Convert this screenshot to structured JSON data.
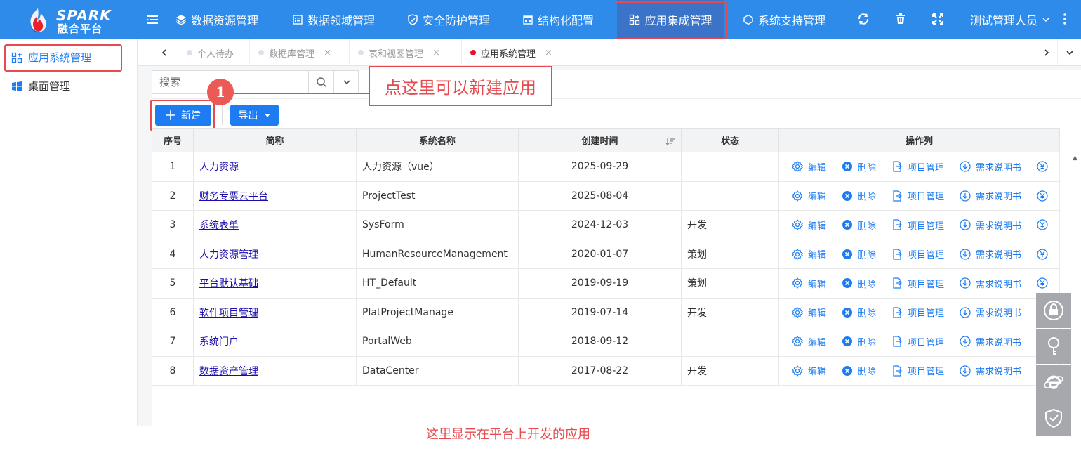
{
  "logo": {
    "top": "SPARK",
    "bottom": "融合平台"
  },
  "nav": [
    {
      "label": "数据资源管理",
      "icon": "layers-icon"
    },
    {
      "label": "数据领域管理",
      "icon": "document-icon"
    },
    {
      "label": "安全防护管理",
      "icon": "shield-icon"
    },
    {
      "label": "结构化配置",
      "icon": "calendar-icon"
    },
    {
      "label": "应用集成管理",
      "icon": "apps-icon",
      "active": true
    },
    {
      "label": "系统支持管理",
      "icon": "hexagon-icon"
    }
  ],
  "toolbar_icons": [
    "refresh-icon",
    "trash-icon",
    "fullscreen-icon",
    "more-icon"
  ],
  "user": {
    "name": "测试管理人员"
  },
  "sidebar": {
    "items": [
      {
        "label": "应用系统管理",
        "icon": "apps-icon",
        "active": true
      },
      {
        "label": "桌面管理",
        "icon": "windows-icon"
      }
    ]
  },
  "tabs": [
    {
      "label": "个人待办"
    },
    {
      "label": "数据库管理"
    },
    {
      "label": "表和视图管理"
    },
    {
      "label": "应用系统管理",
      "active": true
    }
  ],
  "search": {
    "placeholder": "搜索"
  },
  "buttons": {
    "new": "新建",
    "export": "导出"
  },
  "table": {
    "headers": [
      "序号",
      "简称",
      "系统名称",
      "创建时间",
      "状态",
      "操作列"
    ],
    "actions": [
      "编辑",
      "删除",
      "项目管理",
      "需求说明书"
    ],
    "rows": [
      {
        "no": "1",
        "short": "人力资源",
        "name": "人力资源（vue）",
        "date": "2025-09-29",
        "status": ""
      },
      {
        "no": "2",
        "short": "财务专票云平台",
        "name": "ProjectTest",
        "date": "2025-08-04",
        "status": ""
      },
      {
        "no": "3",
        "short": "系统表单",
        "name": "SysForm",
        "date": "2024-12-03",
        "status": "开发"
      },
      {
        "no": "4",
        "short": "人力资源管理",
        "name": "HumanResourceManagement",
        "date": "2020-01-07",
        "status": "策划"
      },
      {
        "no": "5",
        "short": "平台默认基础",
        "name": "HT_Default",
        "date": "2019-09-19",
        "status": "策划"
      },
      {
        "no": "6",
        "short": "软件项目管理",
        "name": "PlatProjectManage",
        "date": "2019-07-14",
        "status": "开发"
      },
      {
        "no": "7",
        "short": "系统门户",
        "name": "PortalWeb",
        "date": "2018-09-12",
        "status": ""
      },
      {
        "no": "8",
        "short": "数据资产管理",
        "name": "DataCenter",
        "date": "2017-08-22",
        "status": "开发"
      }
    ]
  },
  "annotations": {
    "badge": "1",
    "callout": "点这里可以新建应用",
    "bottom_note": "这里显示在平台上开发的应用"
  },
  "colors": {
    "topbar": "#2e8bea",
    "nav_active": "#3b73c9",
    "primary": "#1e7cf2",
    "annotation": "#e64a4f"
  }
}
